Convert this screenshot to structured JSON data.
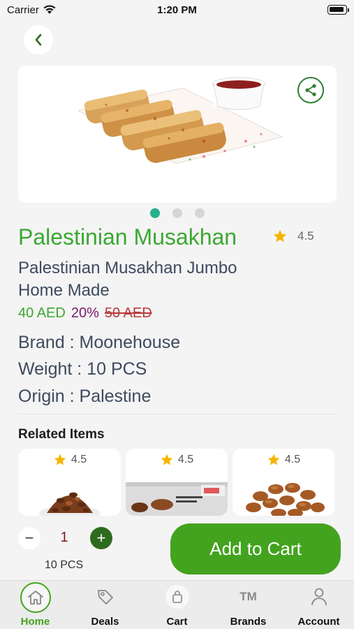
{
  "status_bar": {
    "carrier": "Carrier",
    "time": "1:20 PM"
  },
  "product": {
    "title": "Palestinian Musakhan",
    "rating": "4.5",
    "subtitle": "Palestinian Musakhan Jumbo Home Made",
    "price_new": "40 AED",
    "discount": "20%",
    "price_old": "50 AED",
    "brand": "Brand : Moonehouse",
    "weight": "Weight : 10 PCS",
    "origin": "Origin : Palestine",
    "gallery": {
      "count": 3,
      "active_index": 0
    }
  },
  "related": {
    "heading": "Related Items",
    "items": [
      {
        "rating": "4.5"
      },
      {
        "rating": "4.5"
      },
      {
        "rating": "4.5"
      }
    ]
  },
  "cart_controls": {
    "minus": "−",
    "quantity": "1",
    "plus": "+",
    "unit": "10 PCS",
    "add_to_cart": "Add to Cart"
  },
  "tabbar": {
    "items": [
      {
        "label": "Home",
        "icon": "home-icon",
        "active": true
      },
      {
        "label": "Deals",
        "icon": "tag-icon",
        "active": false
      },
      {
        "label": "Cart",
        "icon": "shopping-bag-icon",
        "active": false
      },
      {
        "label": "Brands",
        "icon": "trademark-icon",
        "active": false
      },
      {
        "label": "Account",
        "icon": "user-icon",
        "active": false
      }
    ],
    "brand_icon_text": "TM"
  },
  "colors": {
    "primary_green": "#43a31f",
    "title_green": "#3aa832",
    "dark_green": "#2f6b1e",
    "discount_purple": "#7b1a6a",
    "old_price_red": "#b83a3a",
    "active_dot": "#26b08f",
    "star": "#f7b500"
  }
}
